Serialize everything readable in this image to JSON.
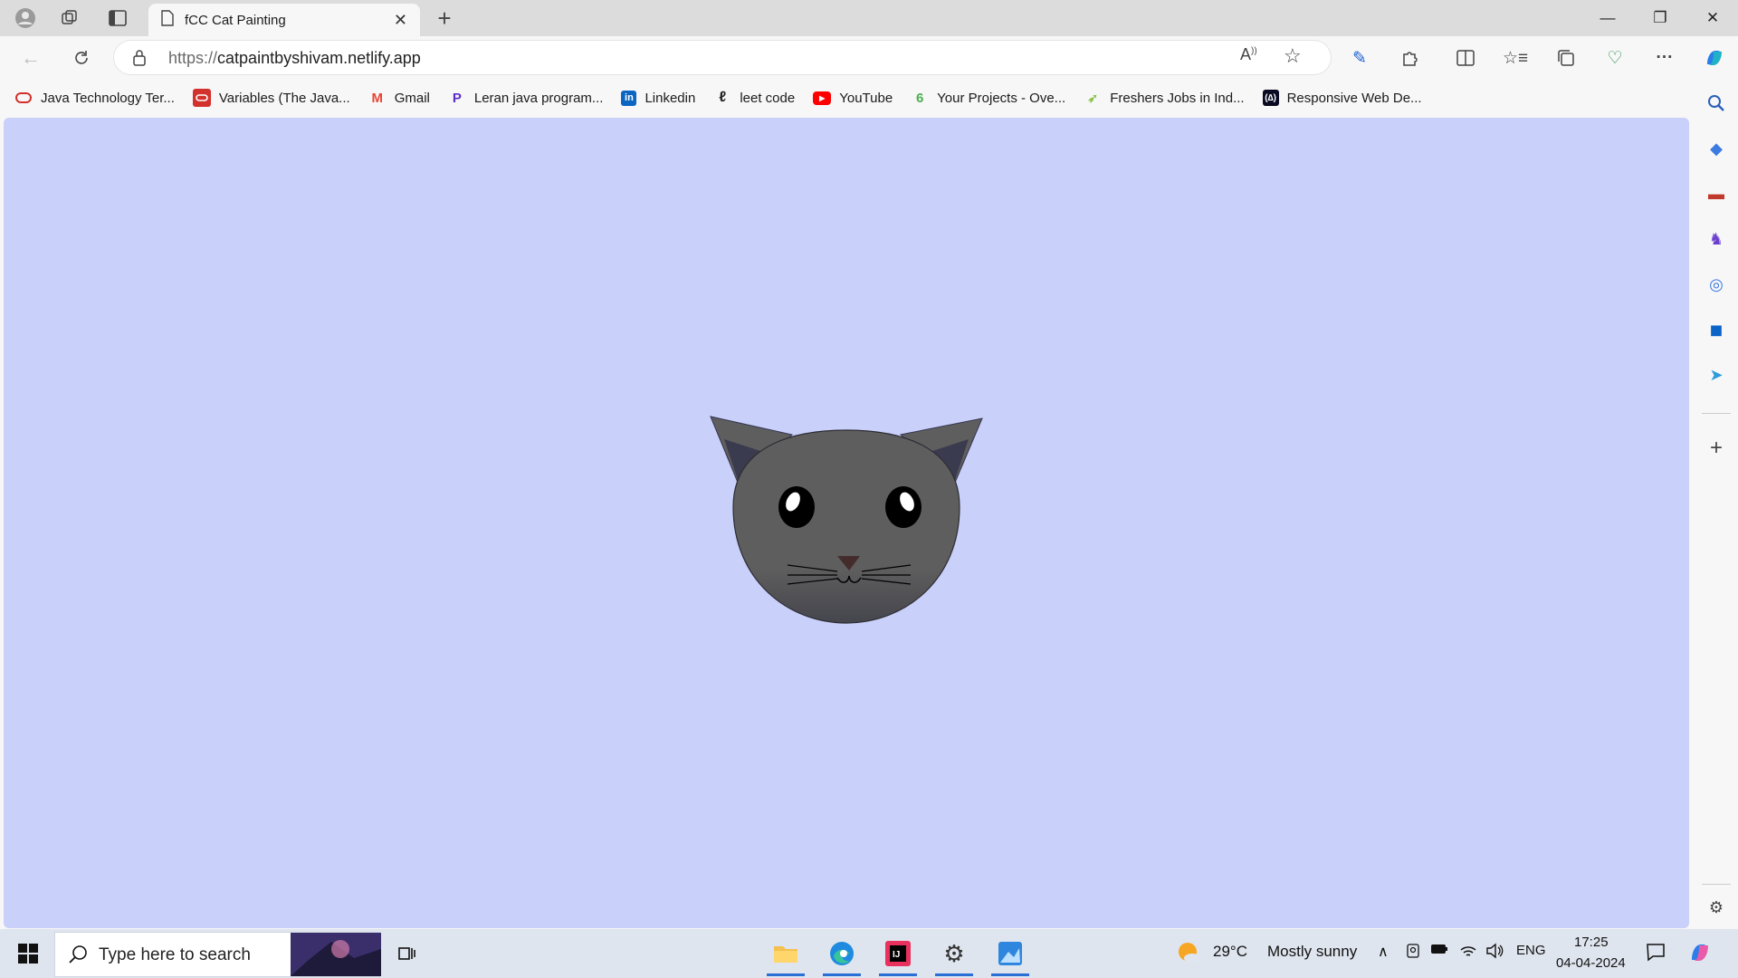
{
  "browser": {
    "tab_title": "fCC Cat Painting",
    "url_protocol": "https://",
    "url_host": "catpaintbyshivam.netlify.app",
    "icons": [
      "profile-icon",
      "workspaces-icon",
      "vertical-tabs-icon",
      "page-icon",
      "close-icon",
      "new-tab-icon",
      "back-icon",
      "refresh-icon",
      "lock-icon",
      "read-aloud-icon",
      "favorite-star-icon",
      "copilot-pen-icon",
      "extensions-icon",
      "split-screen-icon",
      "favorites-icon",
      "collections-icon",
      "browser-essentials-icon",
      "more-icon",
      "copilot-icon",
      "minimize-icon",
      "restore-icon",
      "close-window-icon"
    ]
  },
  "bookmarks": [
    {
      "label": "Java Technology Ter...",
      "icon": "oracle-icon",
      "color": "#d3312b"
    },
    {
      "label": "Variables (The Java...",
      "icon": "oracle-box-icon",
      "color": "#d3312b"
    },
    {
      "label": "Gmail",
      "icon": "gmail-icon",
      "color": "#ea4335"
    },
    {
      "label": "Leran java program...",
      "icon": "p-icon",
      "color": "#5b2ec9"
    },
    {
      "label": "Linkedin",
      "icon": "linkedin-icon",
      "color": "#0a66c2"
    },
    {
      "label": "leet code",
      "icon": "leetcode-icon",
      "color": "#f89f1b"
    },
    {
      "label": "YouTube",
      "icon": "youtube-icon",
      "color": "#ff0000"
    },
    {
      "label": "Your Projects - Ove...",
      "icon": "projects-icon",
      "color": "#4caf50"
    },
    {
      "label": "Freshers Jobs in Ind...",
      "icon": "freshers-icon",
      "color": "#8bc34a"
    },
    {
      "label": "Responsive Web De...",
      "icon": "freecodecamp-icon",
      "color": "#0a0a23"
    }
  ],
  "sidebar": {
    "icons": [
      "search-icon",
      "tag-icon",
      "briefcase-icon",
      "games-icon",
      "m365-icon",
      "outlook-icon",
      "telegram-icon",
      "add-icon",
      "settings-icon"
    ]
  },
  "page": {
    "background": "#c9d0fa",
    "cat_colors": {
      "head": "#5e5e5e",
      "ear": "#5e5e5e",
      "inner_ear": "#3b3b4f",
      "eye": "#000000",
      "nose": "#442c2c"
    }
  },
  "taskbar": {
    "search_placeholder": "Type here to search",
    "weather_temp": "29°C",
    "weather_text": "Mostly sunny",
    "language": "ENG",
    "time": "17:25",
    "date": "04-04-2024",
    "icons": [
      "windows-start-icon",
      "search-icon",
      "task-view-icon",
      "file-explorer-icon",
      "edge-icon",
      "intellij-icon",
      "settings-icon",
      "photos-icon",
      "weather-icon",
      "chevron-up-icon",
      "meet-icon",
      "battery-icon",
      "wifi-icon",
      "volume-icon",
      "notifications-icon",
      "copilot-icon"
    ]
  }
}
